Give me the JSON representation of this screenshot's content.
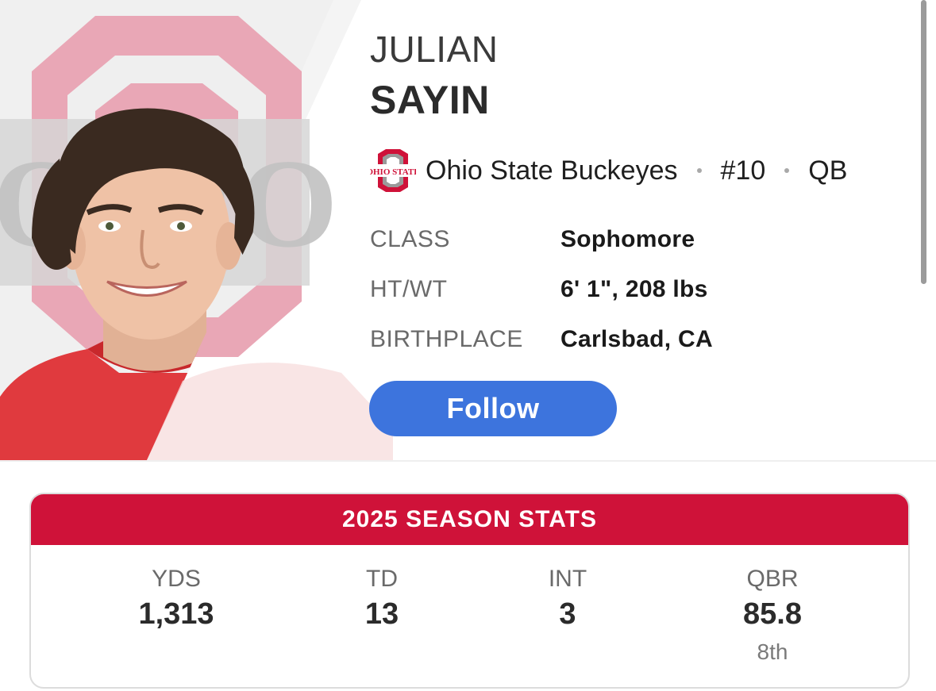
{
  "player": {
    "first_name": "JULIAN",
    "last_name": "SAYIN",
    "team": "Ohio State Buckeyes",
    "number": "#10",
    "position": "QB"
  },
  "bio": [
    {
      "label": "CLASS",
      "value": "Sophomore"
    },
    {
      "label": "HT/WT",
      "value": "6' 1\", 208 lbs"
    },
    {
      "label": "BIRTHPLACE",
      "value": "Carlsbad, CA"
    }
  ],
  "follow_button": {
    "label": "Follow"
  },
  "stats": {
    "title": "2025 SEASON STATS",
    "items": [
      {
        "label": "YDS",
        "value": "1,313",
        "rank": ""
      },
      {
        "label": "TD",
        "value": "13",
        "rank": ""
      },
      {
        "label": "INT",
        "value": "3",
        "rank": ""
      },
      {
        "label": "QBR",
        "value": "85.8",
        "rank": "8th"
      }
    ]
  },
  "colors": {
    "team_red": "#cf1239",
    "follow_blue": "#3d74dd",
    "logo_gray": "#9a9a9a"
  },
  "icons": {
    "team_logo": "ohio-state-block-o-logo",
    "headshot": "player-headshot-photo"
  }
}
